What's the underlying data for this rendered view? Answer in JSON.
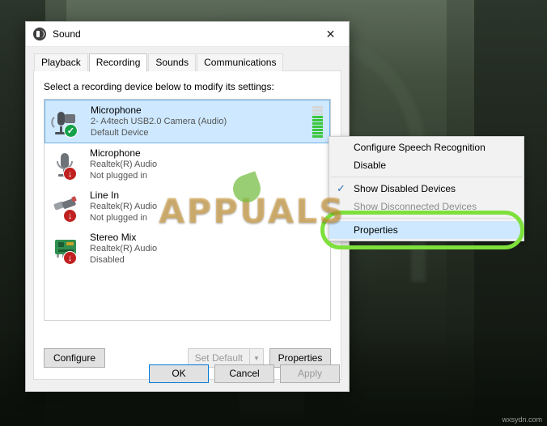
{
  "desktop": {
    "watermark_text": "APPUALS",
    "corner_credit": "wxsydn.com"
  },
  "dialog": {
    "title": "Sound",
    "close_label": "✕",
    "tabs": [
      {
        "label": "Playback",
        "selected": false
      },
      {
        "label": "Recording",
        "selected": true
      },
      {
        "label": "Sounds",
        "selected": false
      },
      {
        "label": "Communications",
        "selected": false
      }
    ],
    "prompt": "Select a recording device below to modify its settings:",
    "devices": [
      {
        "name": "Microphone",
        "detail": "2- A4tech USB2.0 Camera (Audio)",
        "status": "Default Device",
        "badge": "check",
        "selected": true,
        "meter_level": 7
      },
      {
        "name": "Microphone",
        "detail": "Realtek(R) Audio",
        "status": "Not plugged in",
        "badge": "down",
        "selected": false,
        "meter_level": 0
      },
      {
        "name": "Line In",
        "detail": "Realtek(R) Audio",
        "status": "Not plugged in",
        "badge": "down",
        "selected": false,
        "meter_level": 0
      },
      {
        "name": "Stereo Mix",
        "detail": "Realtek(R) Audio",
        "status": "Disabled",
        "badge": "down",
        "selected": false,
        "meter_level": 0
      }
    ],
    "buttons": {
      "configure": "Configure",
      "set_default": "Set Default",
      "set_default_arrow": "▼",
      "properties": "Properties"
    },
    "footer": {
      "ok": "OK",
      "cancel": "Cancel",
      "apply": "Apply"
    }
  },
  "context_menu": {
    "items": [
      {
        "label": "Configure Speech Recognition",
        "checked": false,
        "dim": false,
        "highlight": false
      },
      {
        "label": "Disable",
        "checked": false,
        "dim": false,
        "highlight": false
      },
      {
        "separator": true
      },
      {
        "label": "Show Disabled Devices",
        "checked": true,
        "dim": false,
        "highlight": false
      },
      {
        "label": "Show Disconnected Devices",
        "checked": false,
        "dim": true,
        "highlight": false
      },
      {
        "separator": true
      },
      {
        "label": "Properties",
        "checked": false,
        "dim": false,
        "highlight": true
      }
    ],
    "check_glyph": "✓"
  },
  "colors": {
    "highlight_ring": "#7ee03c",
    "selection": "#cde8ff",
    "accent": "#0078d7"
  }
}
